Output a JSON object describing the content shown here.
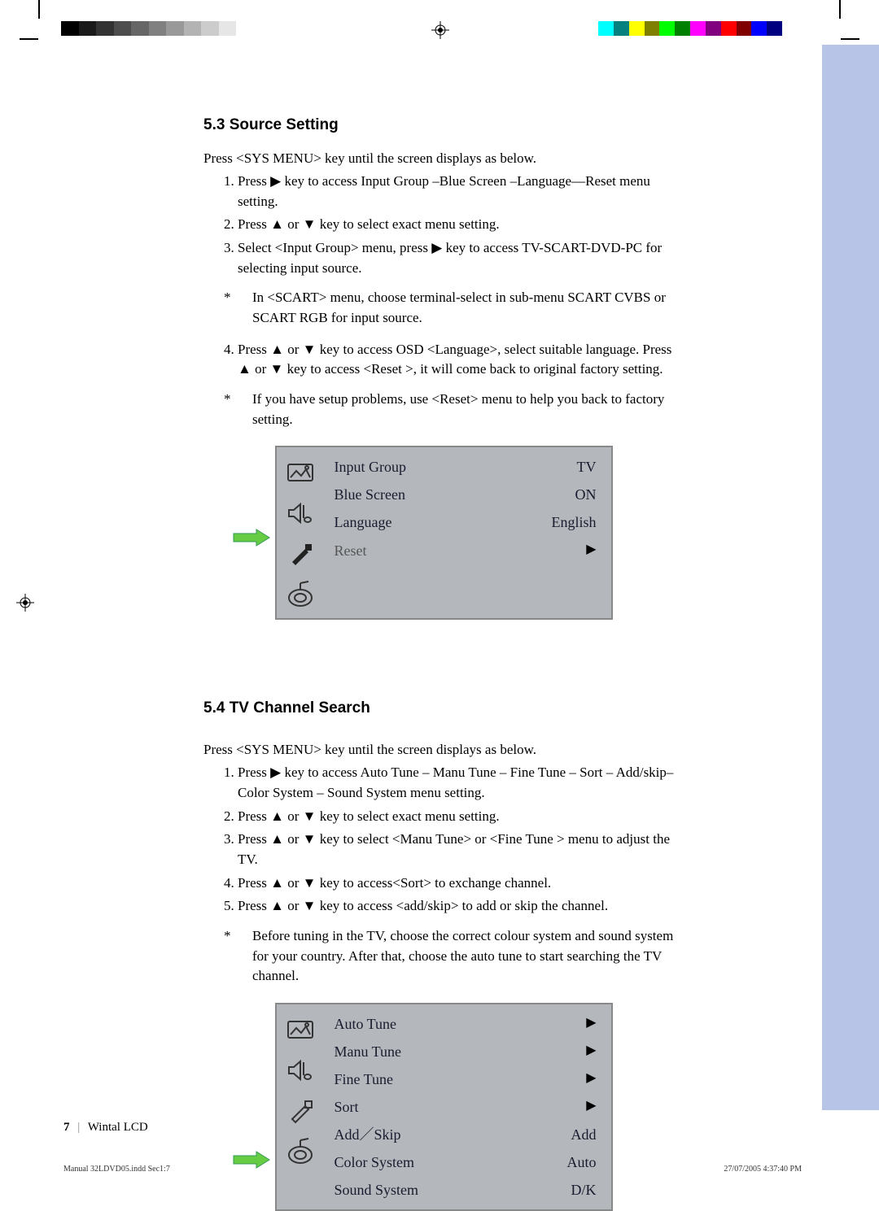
{
  "colorbar_left": [
    "#000",
    "#1a1a1a",
    "#333",
    "#4d4d4d",
    "#666",
    "#808080",
    "#999",
    "#b3b3b3",
    "#ccc",
    "#e6e6e6"
  ],
  "colorbar_right": [
    "#0ff",
    "#078080",
    "#ff0",
    "#808000",
    "#0f0",
    "#008000",
    "#f0f",
    "#800080",
    "#f00",
    "#800000",
    "#00f",
    "#000080",
    "#fff"
  ],
  "s53": {
    "title": "5.3  Source Setting",
    "intro": "Press <SYS MENU> key until the screen displays as below.",
    "li1": "Press ▶ key to access Input Group –Blue Screen –Language—Reset menu setting.",
    "li2": "Press ▲ or ▼ key to select exact menu setting.",
    "li3": "Select <Input Group> menu, press ▶ key to access TV-SCART-DVD-PC for selecting input source.",
    "sub3": "In <SCART> menu, choose terminal-select in sub-menu SCART CVBS or SCART RGB for input source.",
    "li4": "Press ▲ or ▼ key to access OSD <Language>, select suitable language. Press ▲ or ▼ key to access <Reset >, it will come back to original factory setting.",
    "sub4": "If you have setup problems, use <Reset> menu to help you back to factory setting."
  },
  "osd1": {
    "r1l": "Input Group",
    "r1v": "TV",
    "r2l": "Blue Screen",
    "r2v": "ON",
    "r3l": "Language",
    "r3v": "English",
    "r4l": "Reset",
    "r4v": "▶"
  },
  "s54": {
    "title": "5.4  TV Channel Search",
    "intro": "Press <SYS MENU> key until the screen displays as below.",
    "li1": "Press ▶ key to access Auto Tune – Manu Tune – Fine Tune – Sort – Add/skip– Color System – Sound System menu setting.",
    "li2": "Press ▲ or ▼ key to select exact menu setting.",
    "li3": "Press ▲ or ▼ key to select <Manu Tune> or <Fine Tune > menu to adjust the TV.",
    "li4": "Press ▲ or ▼ key to access<Sort> to exchange channel.",
    "li5": "Press ▲ or ▼ key to access <add/skip> to add or skip the channel.",
    "sub": "Before tuning in the TV, choose the correct colour system and sound system for your country. After that, choose the auto tune to start searching the TV channel."
  },
  "osd2": {
    "r1l": "Auto Tune",
    "r1v": "▶",
    "r2l": "Manu Tune",
    "r2v": "▶",
    "r3l": "Fine Tune",
    "r3v": "▶",
    "r4l": "Sort",
    "r4v": "▶",
    "r5l": "Add／Skip",
    "r5v": "Add",
    "r6l": "Color System",
    "r6v": "Auto",
    "r7l": "Sound System",
    "r7v": "D/K"
  },
  "footer": {
    "page": "7",
    "sep": "|",
    "title": "Wintal LCD",
    "indd": "Manual 32LDVD05.indd   Sec1:7",
    "date": "27/07/2005   4:37:40 PM"
  }
}
